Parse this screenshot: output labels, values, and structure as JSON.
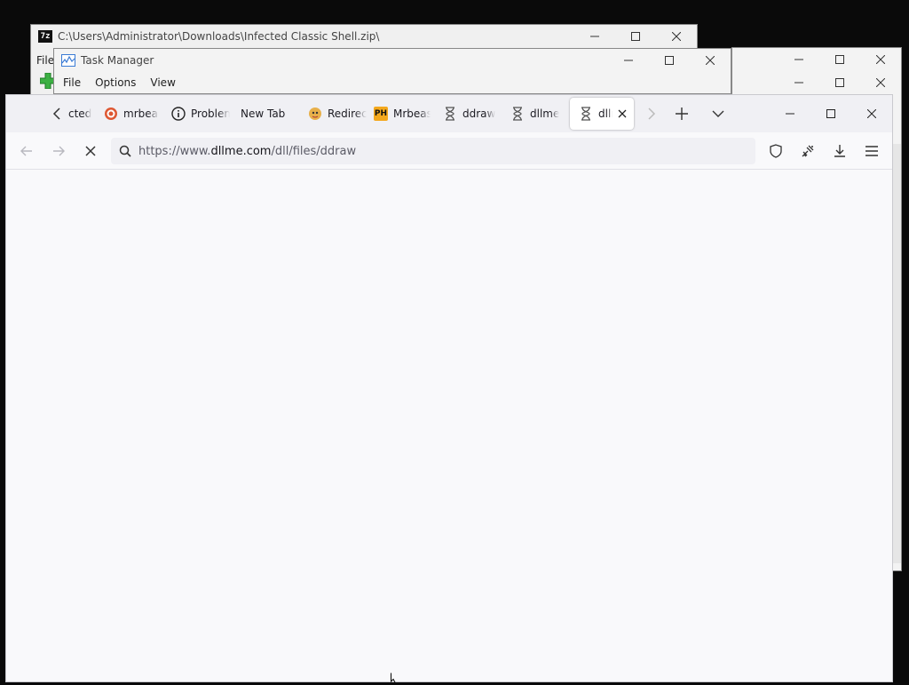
{
  "sevenzip": {
    "title": "C:\\Users\\Administrator\\Downloads\\Infected Classic Shell.zip\\",
    "menu_file": "File",
    "logo_text": "7z"
  },
  "taskmanager": {
    "title": "Task Manager",
    "menu": [
      "File",
      "Options",
      "View"
    ]
  },
  "firefox": {
    "tabs": [
      {
        "label": "cted",
        "icon": "none"
      },
      {
        "label": "mrbeast",
        "icon": "duckduckgo-icon"
      },
      {
        "label": "Problem",
        "icon": "info-icon"
      },
      {
        "label": "New Tab",
        "icon": "none"
      },
      {
        "label": "Redirect",
        "icon": "avatar-icon"
      },
      {
        "label": "Mrbeast",
        "icon": "ph-icon"
      },
      {
        "label": "ddraw",
        "icon": "hourglass-icon"
      },
      {
        "label": "dllme",
        "icon": "hourglass-icon"
      },
      {
        "label": "dllme",
        "icon": "hourglass-icon"
      }
    ],
    "url_prefix": "https://www.",
    "url_domain": "dllme.com",
    "url_path": "/dll/files/ddraw"
  },
  "colors": {
    "accent": "#0060df",
    "tabbar_bg": "#f0f0f4",
    "content_bg": "#f9f9fb"
  }
}
